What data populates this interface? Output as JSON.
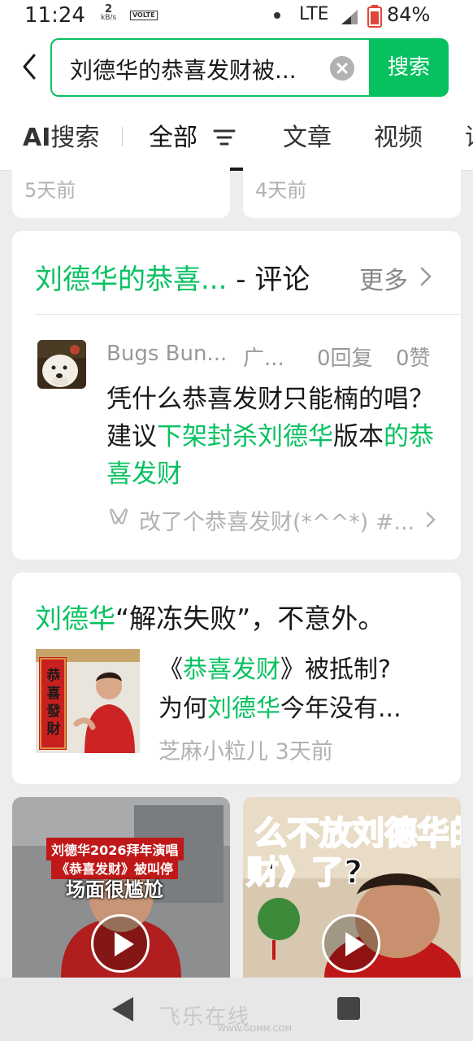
{
  "status_bar": {
    "time": "11:24",
    "speed_value": "2",
    "speed_unit": "kB/s",
    "volte": "VOLTE",
    "network": "LTE",
    "battery": "84%"
  },
  "search": {
    "query": "刘德华的恭喜发财被...",
    "button": "搜索"
  },
  "tabs": {
    "ai_prefix": "AI",
    "ai_suffix": "搜索",
    "all": "全部",
    "article": "文章",
    "video": "视频",
    "more_partial": "话"
  },
  "top_cards": {
    "left_time": "5天前",
    "right_time": "4天前"
  },
  "comment_section": {
    "title_green": "刘德华的恭喜...",
    "title_suffix": " - 评论",
    "more": "更多",
    "comment": {
      "user": "Bugs Bun...",
      "source": "广...",
      "replies": "0回复",
      "likes": "0赞",
      "body_part1": "凭什么恭喜发财只能楠的唱？建议",
      "body_green1": "下架封杀刘德华",
      "body_part2": "版本",
      "body_green2": "的恭喜发财",
      "reference": "改了个恭喜发财(*^^*) #..."
    }
  },
  "article": {
    "title_green": "刘德华",
    "title_rest": "“解冻失败”，不意外。",
    "line1_a": "《",
    "line1_green": "恭喜发财",
    "line1_b": "》被抵制?",
    "line2_a": "为何",
    "line2_green": "刘德华",
    "line2_b": "今年没有...",
    "author": "芝麻小粒儿",
    "time": "3天前",
    "thumb_text": "恭喜發財"
  },
  "videos": {
    "left_caption1": "刘德华2026拜年演唱",
    "left_caption2": "《恭喜发财》被叫停",
    "left_caption3": "场面很尴尬",
    "right_text1": "么不放刘德华的",
    "right_text2": "财》了?"
  },
  "navbar": {
    "watermark_logo": "飞乐在线",
    "watermark_url": "WWW.GDMM.COM"
  },
  "colors": {
    "accent": "#07c160",
    "background": "#ededed"
  }
}
